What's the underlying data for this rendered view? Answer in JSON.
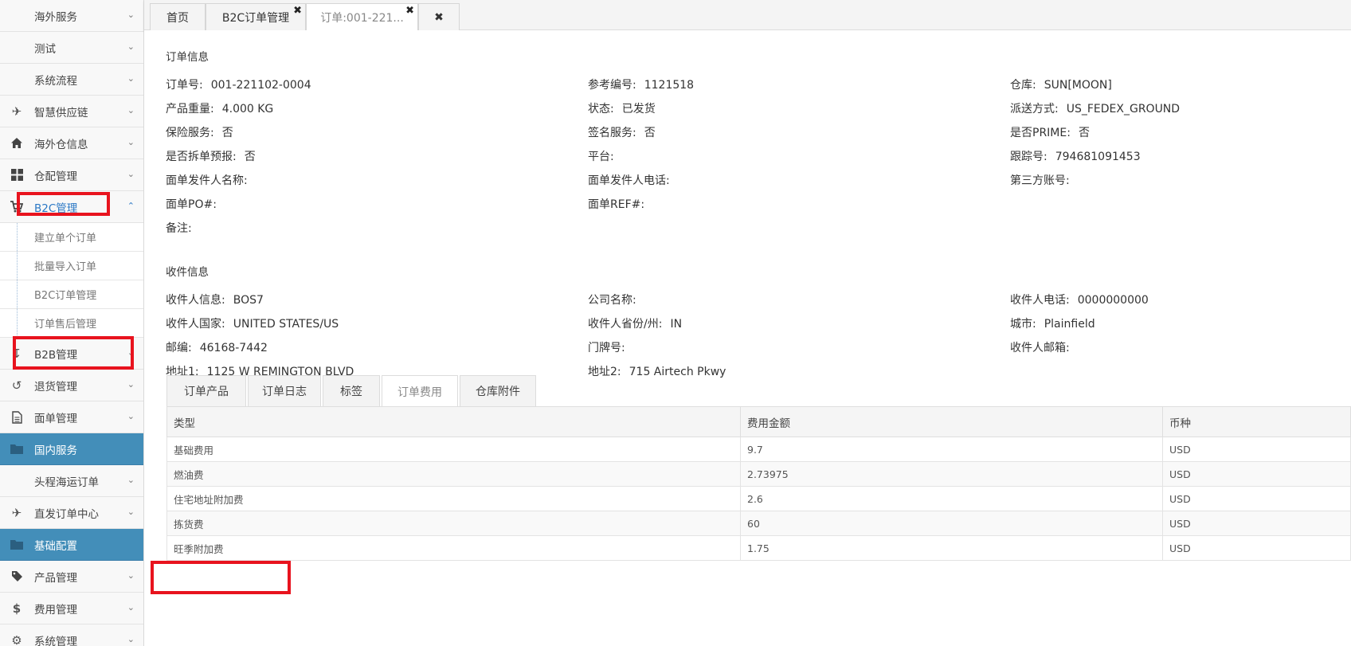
{
  "sidebar": {
    "items_top": [
      {
        "label": "海外服务",
        "icon": "none"
      },
      {
        "label": "测试",
        "icon": "none"
      },
      {
        "label": "系统流程",
        "icon": "none"
      },
      {
        "label": "智慧供应链",
        "icon": "plane-icon"
      },
      {
        "label": "海外仓信息",
        "icon": "home-icon"
      },
      {
        "label": "仓配管理",
        "icon": "grid-icon"
      },
      {
        "label": "B2C管理",
        "icon": "cart-icon"
      }
    ],
    "b2c_sub": [
      "建立单个订单",
      "批量导入订单",
      "B2C订单管理",
      "订单售后管理"
    ],
    "items_bottom": [
      {
        "label": "B2B管理",
        "icon": "download-icon"
      },
      {
        "label": "退货管理",
        "icon": "undo-icon"
      },
      {
        "label": "面单管理",
        "icon": "file-icon"
      },
      {
        "label": "国内服务",
        "icon": "folder-icon"
      },
      {
        "label": "头程海运订单",
        "icon": "none"
      },
      {
        "label": "直发订单中心",
        "icon": "plane-icon"
      },
      {
        "label": "基础配置",
        "icon": "folder-icon"
      },
      {
        "label": "产品管理",
        "icon": "tag-icon"
      },
      {
        "label": "费用管理",
        "icon": "dollar-icon"
      },
      {
        "label": "系统管理",
        "icon": "gear-icon"
      }
    ]
  },
  "tabs": [
    {
      "label": "首页"
    },
    {
      "label": "B2C订单管理"
    },
    {
      "label": "订单:001-221..."
    }
  ],
  "order_info": {
    "title": "订单信息",
    "fields": [
      {
        "k": "订单号:",
        "v": "001-221102-0004"
      },
      {
        "k": "参考编号:",
        "v": "1121518"
      },
      {
        "k": "仓库:",
        "v": "SUN[MOON]"
      },
      {
        "k": "产品重量:",
        "v": "4.000 KG"
      },
      {
        "k": "状态:",
        "v": "已发货"
      },
      {
        "k": "派送方式:",
        "v": "US_FEDEX_GROUND"
      },
      {
        "k": "保险服务:",
        "v": "否"
      },
      {
        "k": "签名服务:",
        "v": "否"
      },
      {
        "k": "是否PRIME:",
        "v": "否"
      },
      {
        "k": "是否拆单预报:",
        "v": "否"
      },
      {
        "k": "平台:",
        "v": ""
      },
      {
        "k": "跟踪号:",
        "v": "794681091453"
      },
      {
        "k": "面单发件人名称:",
        "v": ""
      },
      {
        "k": "面单发件人电话:",
        "v": ""
      },
      {
        "k": "第三方账号:",
        "v": ""
      },
      {
        "k": "面单PO#:",
        "v": ""
      },
      {
        "k": "面单REF#:",
        "v": ""
      },
      {
        "k": "备注:",
        "v": ""
      }
    ]
  },
  "receiver_info": {
    "title": "收件信息",
    "fields": [
      {
        "k": "收件人信息:",
        "v": "BOS7"
      },
      {
        "k": "公司名称:",
        "v": ""
      },
      {
        "k": "收件人电话:",
        "v": "0000000000"
      },
      {
        "k": "收件人国家:",
        "v": "UNITED STATES/US"
      },
      {
        "k": "收件人省份/州:",
        "v": "IN"
      },
      {
        "k": "城市:",
        "v": "Plainfield"
      },
      {
        "k": "邮编:",
        "v": "46168-7442"
      },
      {
        "k": "门牌号:",
        "v": ""
      },
      {
        "k": "收件人邮箱:",
        "v": ""
      },
      {
        "k": "地址1:",
        "v": "1125 W REMINGTON BLVD"
      },
      {
        "k": "地址2:",
        "v": "715 Airtech Pkwy"
      }
    ]
  },
  "detail_tabs": [
    "订单产品",
    "订单日志",
    "标签",
    "订单费用",
    "仓库附件"
  ],
  "fee_table": {
    "headers": [
      "类型",
      "费用金额",
      "币种"
    ],
    "rows": [
      [
        "基础费用",
        "9.7",
        "USD"
      ],
      [
        "燃油费",
        "2.73975",
        "USD"
      ],
      [
        "住宅地址附加费",
        "2.6",
        "USD"
      ],
      [
        "拣货费",
        "60",
        "USD"
      ],
      [
        "旺季附加费",
        "1.75",
        "USD"
      ]
    ]
  },
  "colors": {
    "section_blue": "#438eb9",
    "highlight_red": "#e8131e",
    "active_link": "#2a78c5"
  }
}
